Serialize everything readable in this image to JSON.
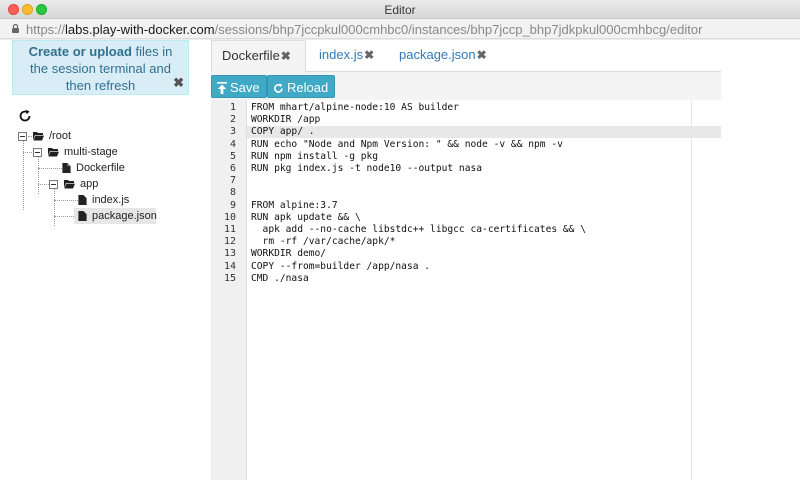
{
  "window": {
    "title": "Editor"
  },
  "address_bar": {
    "scheme": "https://",
    "host": "labs.play-with-docker.com",
    "path": "/sessions/bhp7jccpkul000cmhbc0/instances/bhp7jccp_bhp7jdkpkul000cmhbcg/editor"
  },
  "notice": {
    "bold_text": "Create or upload",
    "text": " files in the session terminal and then refresh",
    "close": "✖"
  },
  "tree": {
    "root": "/root",
    "multi_stage": "multi-stage",
    "dockerfile": "Dockerfile",
    "app": "app",
    "index_js": "index.js",
    "package_json": "package.json"
  },
  "tabs": [
    {
      "label": "Dockerfile",
      "close": "✖",
      "active": true
    },
    {
      "label": "index.js",
      "close": "✖",
      "active": false
    },
    {
      "label": "package.json",
      "close": "✖",
      "active": false
    }
  ],
  "toolbar": {
    "save_label": "Save",
    "reload_label": "Reload"
  },
  "editor": {
    "active_line": 3,
    "lines": [
      "FROM mhart/alpine-node:10 AS builder",
      "WORKDIR /app",
      "COPY app/ .",
      "RUN echo \"Node and Npm Version: \" && node -v && npm -v",
      "RUN npm install -g pkg",
      "RUN pkg index.js -t node10 --output nasa",
      "",
      "",
      "FROM alpine:3.7",
      "RUN apk update && \\",
      "  apk add --no-cache libstdc++ libgcc ca-certificates && \\",
      "  rm -rf /var/cache/apk/*",
      "WORKDIR demo/",
      "COPY --from=builder /app/nasa .",
      "CMD ./nasa"
    ]
  },
  "colors": {
    "accent": "#3fa9c6",
    "notice_bg": "#d9edf7",
    "link": "#337ab7"
  }
}
